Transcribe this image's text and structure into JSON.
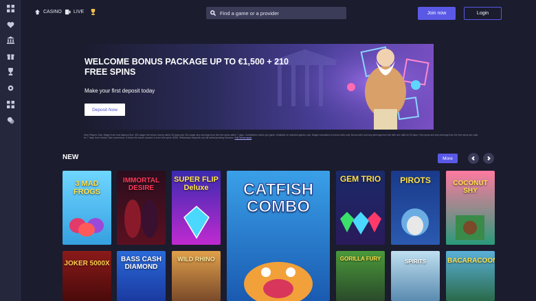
{
  "nav": {
    "casino": "CASINO",
    "live": "LIVE"
  },
  "search": {
    "placeholder": "Find a game or a provider"
  },
  "auth": {
    "join": "Join now",
    "login": "Login"
  },
  "banner": {
    "title": "WELCOME BONUS PACKAGE UP TO €1,500 + 210 FREE SPINS",
    "subtitle": "Make your first deposit today",
    "cta": "Deposit Now"
  },
  "terms": {
    "text": "New Players Only. Wager from real balance first. 40X wager the bonus money within 30 days and 40x wager any winnings from the free spins within 7 days. Contribution varies per game. Available on selected games only. Wager calculated on bonus bets only. Bonus offer and any winnings from the offer are valid for 30 days / free spins and any winnings from the free spins are valid for 7 days from receipt. Max conversion: 3 times the bonus amount or from free spins: €250. Withdrawal requests void all active/pending bonuses.",
    "link": "Full Terms apply"
  },
  "section": {
    "title": "NEW",
    "more": "More"
  },
  "games": [
    {
      "title": "3 MAD FROGS"
    },
    {
      "title": "IMMORTAL DESIRE"
    },
    {
      "title": "SUPER FLIP Deluxe"
    },
    {
      "title": "CATFISH COMBO"
    },
    {
      "title": "GEM TRIO"
    },
    {
      "title": "PIROTS"
    },
    {
      "title": "COCONUT SHY"
    },
    {
      "title": "JOKER 5000X"
    },
    {
      "title": "BASS CASH DIAMOND"
    },
    {
      "title": "WILD RHINO"
    },
    {
      "title": "GORILLA FURY"
    },
    {
      "title": "SPIRITS"
    },
    {
      "title": "BACARACOON"
    }
  ],
  "colors": {
    "accent": "#5a59e6",
    "background": "#1b1c2e",
    "sidebar": "#25273d"
  }
}
